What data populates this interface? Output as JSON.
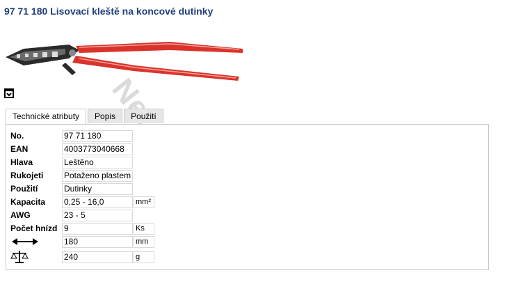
{
  "header": {
    "title": "97 71 180 Lisovací kleště na koncové dutinky"
  },
  "image": {
    "watermark": "Nerezka",
    "print_icon": "print-icon"
  },
  "tabs": [
    {
      "label": "Technické atributy",
      "active": true
    },
    {
      "label": "Popis",
      "active": false
    },
    {
      "label": "Použití",
      "active": false
    }
  ],
  "attributes": [
    {
      "label": "No.",
      "value": "97 71 180",
      "unit": ""
    },
    {
      "label": "EAN",
      "value": "4003773040668",
      "unit": ""
    },
    {
      "label": "Hlava",
      "value": "Leštěno",
      "unit": ""
    },
    {
      "label": "Rukojeti",
      "value": "Potaženo plastem",
      "unit": ""
    },
    {
      "label": "Použití",
      "value": "Dutinky",
      "unit": ""
    },
    {
      "label": "Kapacita",
      "value": "0,25 - 16,0",
      "unit": "mm²"
    },
    {
      "label": "AWG",
      "value": "23 - 5",
      "unit": ""
    },
    {
      "label": "Počet hnízd",
      "value": "9",
      "unit": "Ks"
    },
    {
      "label": "",
      "icon": "length-arrows-icon",
      "value": "180",
      "unit": "mm"
    },
    {
      "label": "",
      "icon": "scale-weight-icon",
      "value": "240",
      "unit": "g"
    }
  ],
  "colors": {
    "title": "#1f3f7a",
    "handle": "#d9342b"
  }
}
